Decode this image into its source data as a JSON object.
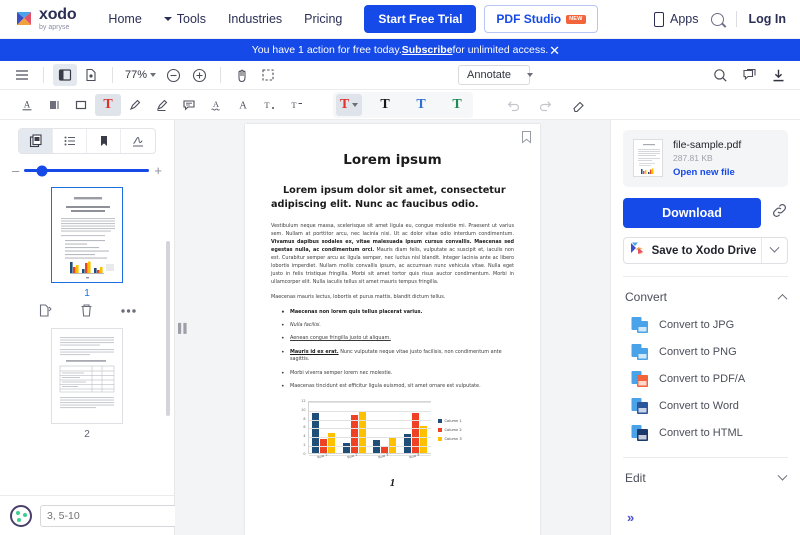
{
  "site_header": {
    "logo_name": "xodo",
    "logo_sub": "by apryse",
    "nav": [
      {
        "label": "Home",
        "caret": false
      },
      {
        "label": "Tools",
        "caret": true
      },
      {
        "label": "Industries",
        "caret": false
      },
      {
        "label": "Pricing",
        "caret": false
      }
    ],
    "trial_button": "Start Free Trial",
    "studio_button": "PDF Studio",
    "studio_badge": "NEW",
    "apps_label": "Apps",
    "login_label": "Log In",
    "accent_color": "#1549e8"
  },
  "notice": {
    "text_before": "You have 1 action for free today. ",
    "link": "Subscribe",
    "text_after": " for unlimited access.",
    "close": "✕"
  },
  "pdf_toolbar": {
    "zoom_value": "77%",
    "mode_label": "Annotate",
    "icons": [
      "menu-icon",
      "sidebar-panel-icon",
      "page-manipulation-icon",
      "zoom-out-icon",
      "zoom-in-icon",
      "pan-icon",
      "select-area-icon",
      "search-icon",
      "comments-icon",
      "download-icon"
    ]
  },
  "annot_bar": {
    "tools": [
      "underline-text-icon",
      "strikeout-text-icon",
      "rectangle-icon",
      "free-text-icon",
      "pen-icon",
      "highlighter-icon",
      "note-icon",
      "squiggly-icon",
      "text-style-icon",
      "subscript-icon",
      "superscript-icon"
    ],
    "font_group": [
      "T",
      "T",
      "T",
      "T"
    ],
    "right_tools": [
      "undo-icon",
      "redo-icon",
      "eraser-icon"
    ]
  },
  "left_panel": {
    "tabs": [
      "thumbnails-tab",
      "outline-tab",
      "bookmarks-tab",
      "signature-tab"
    ],
    "zoom_minus": "–",
    "zoom_plus": "+",
    "thumbnails": [
      {
        "number": "1",
        "selected": true
      },
      {
        "number": "2",
        "selected": false
      }
    ],
    "actions": [
      "duplicate-page-icon",
      "delete-page-icon",
      "more-options-icon"
    ],
    "page_input_placeholder": "3, 5-10"
  },
  "document": {
    "title": "Lorem ipsum",
    "subtitle": "Lorem ipsum dolor sit amet, consectetur adipiscing elit. Nunc ac faucibus odio.",
    "paragraph1_a": "Vestibulum neque massa, scelerisque sit amet ligula eu, congue molestie mi. Praesent ut varius sem. Nullam at porttitor arcu, nec lacinia nisi. Ut ac dolor vitae odio interdum condimentum. ",
    "paragraph1_b": "Vivamus dapibus sodales ex, vitae malesuada ipsum cursus convallis. Maecenas sed egestas nulla, ac condimentum orci.",
    "paragraph1_c": " Mauris diam felis, vulputate ac suscipit et, iaculis non est. Curabitur semper arcu ac ligula semper, nec luctus nisl blandit. Integer lacinia ante ac libero lobortis imperdiet. Nullam mollis convallis ipsum, ac accumsan nunc vehicula vitae. Nulla eget justo in felis tristique fringilla. Morbi sit amet tortor quis risus auctor condimentum. Morbi in ullamcorper elit. Nulla iaculis tellus sit amet mauris tempus fringilla.",
    "paragraph2": "Maecenas mauris lectus, lobortis et purus mattis, blandit dictum tellus.",
    "bullets": [
      {
        "text": "Maecenas non lorem quis tellus placerat varius.",
        "style": "bold"
      },
      {
        "text": "Nulla facilisi.",
        "style": "italic"
      },
      {
        "text": "Aenean congue fringilla justo ut aliquam.",
        "style": "underline"
      },
      {
        "lead": "Mauris id ex erat.",
        "text": " Nunc vulputate neque vitae justo facilisis, non condimentum ante sagittis.",
        "style": "lead-underline"
      },
      {
        "text": "Morbi viverra semper lorem nec molestie.",
        "style": "normal"
      },
      {
        "text": "Maecenas tincidunt est efficitur ligula euismod, sit amet ornare est vulputate.",
        "style": "normal"
      }
    ],
    "page_number": "1"
  },
  "chart_data": {
    "type": "bar",
    "title": "",
    "categories": [
      "Row 1",
      "Row 2",
      "Row 3",
      "Row 4"
    ],
    "series": [
      {
        "name": "Column 1",
        "color": "#1f4e79",
        "values": [
          9.0,
          2.3,
          3.0,
          4.2
        ]
      },
      {
        "name": "Column 2",
        "color": "#ef4123",
        "values": [
          3.1,
          8.7,
          1.6,
          9.0
        ]
      },
      {
        "name": "Column 3",
        "color": "#ffc000",
        "values": [
          4.5,
          9.6,
          3.6,
          6.1
        ]
      }
    ],
    "yticks": [
      0,
      2,
      4,
      6,
      8,
      10,
      12
    ],
    "ylim": [
      0,
      12
    ],
    "xlabel": "",
    "ylabel": "",
    "grid": true,
    "legend_position": "right"
  },
  "right_panel": {
    "file_name": "file-sample.pdf",
    "file_size": "287.81 KB",
    "open_new_file": "Open new file",
    "download_button": "Download",
    "copy_link_icon": "link-icon",
    "drive_button": "Save to Xodo Drive",
    "convert_section": "Convert",
    "convert_items": [
      {
        "label": "Convert to JPG",
        "color": "#4aa3e8"
      },
      {
        "label": "Convert to PNG",
        "color": "#4aa3e8"
      },
      {
        "label": "Convert to PDF/A",
        "color": "#f4643a"
      },
      {
        "label": "Convert to Word",
        "color": "#2b579a"
      },
      {
        "label": "Convert to HTML",
        "color": "#1b3a6b"
      }
    ],
    "edit_section": "Edit",
    "expand_more": "»"
  }
}
